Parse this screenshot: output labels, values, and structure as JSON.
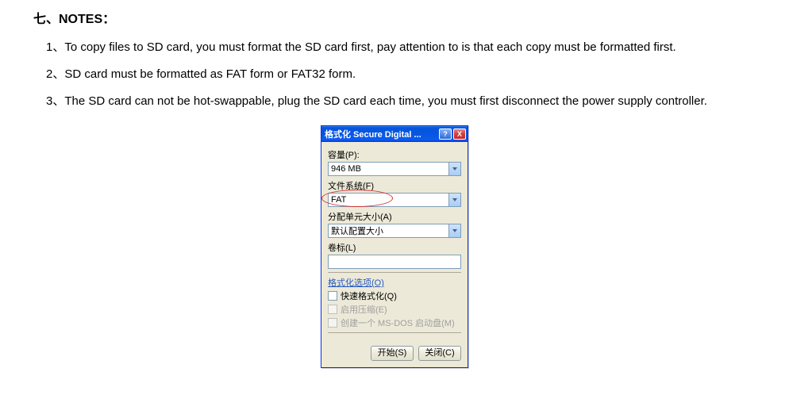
{
  "heading": "七、NOTES：",
  "notes": {
    "n1": "1、To copy files to SD card, you must format the SD card first, pay attention to is that each copy must be formatted first.",
    "n2": "2、SD card must be formatted as FAT form or FAT32 form.",
    "n3": "3、The SD card can not be hot-swappable, plug the SD card each time, you must first disconnect the power supply controller."
  },
  "dialog": {
    "title": "格式化 Secure Digital ...",
    "help_glyph": "?",
    "close_glyph": "X",
    "capacity_label": "容量(P):",
    "capacity_value": "946 MB",
    "fs_label": "文件系统(F)",
    "fs_value": "FAT",
    "alloc_label": "分配单元大小(A)",
    "alloc_value": "默认配置大小",
    "vol_label": "卷标(L)",
    "vol_value": "",
    "options_label": "格式化选项(O)",
    "quick_label": "快速格式化(Q)",
    "compress_label": "启用压缩(E)",
    "msdos_label": "创建一个 MS-DOS 启动盘(M)",
    "start_btn": "开始(S)",
    "close_btn": "关闭(C)"
  }
}
